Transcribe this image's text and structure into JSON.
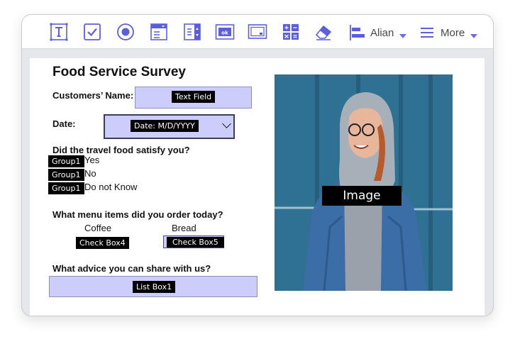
{
  "toolbar": {
    "tools": [
      {
        "icon": "text-field-tool-icon"
      },
      {
        "icon": "checkbox-tool-icon"
      },
      {
        "icon": "radio-button-tool-icon"
      },
      {
        "icon": "dropdown-tool-icon"
      },
      {
        "icon": "list-box-tool-icon"
      },
      {
        "icon": "button-tool-icon",
        "text": "ok"
      },
      {
        "icon": "image-tool-icon"
      },
      {
        "icon": "calculator-tool-icon"
      },
      {
        "icon": "eraser-tool-icon"
      }
    ],
    "align_label": "Alian",
    "more_label": "More",
    "accent": "#5b5fde"
  },
  "form": {
    "title": "Food Service Survey",
    "customers_name_label": "Customers’ Name:",
    "text_field_tag": "Text Field",
    "date_label": "Date:",
    "date_tag": "Date: M/D/YYYY",
    "question_satisfy": "Did the travel food satisfy you?",
    "radio_group_tag": "Group1",
    "radio_options": [
      "Yes",
      "No",
      "Do not Know"
    ],
    "question_menu": "What menu items did you order today?",
    "menu_items": [
      "Coffee",
      "Bread"
    ],
    "checkbox_tags": [
      "Check Box4",
      "Check Box5"
    ],
    "question_advice": "What advice you can share with us?",
    "list_box_tag": "List Box1",
    "image_tag": "Image",
    "field_color": "#cdcdfb"
  }
}
